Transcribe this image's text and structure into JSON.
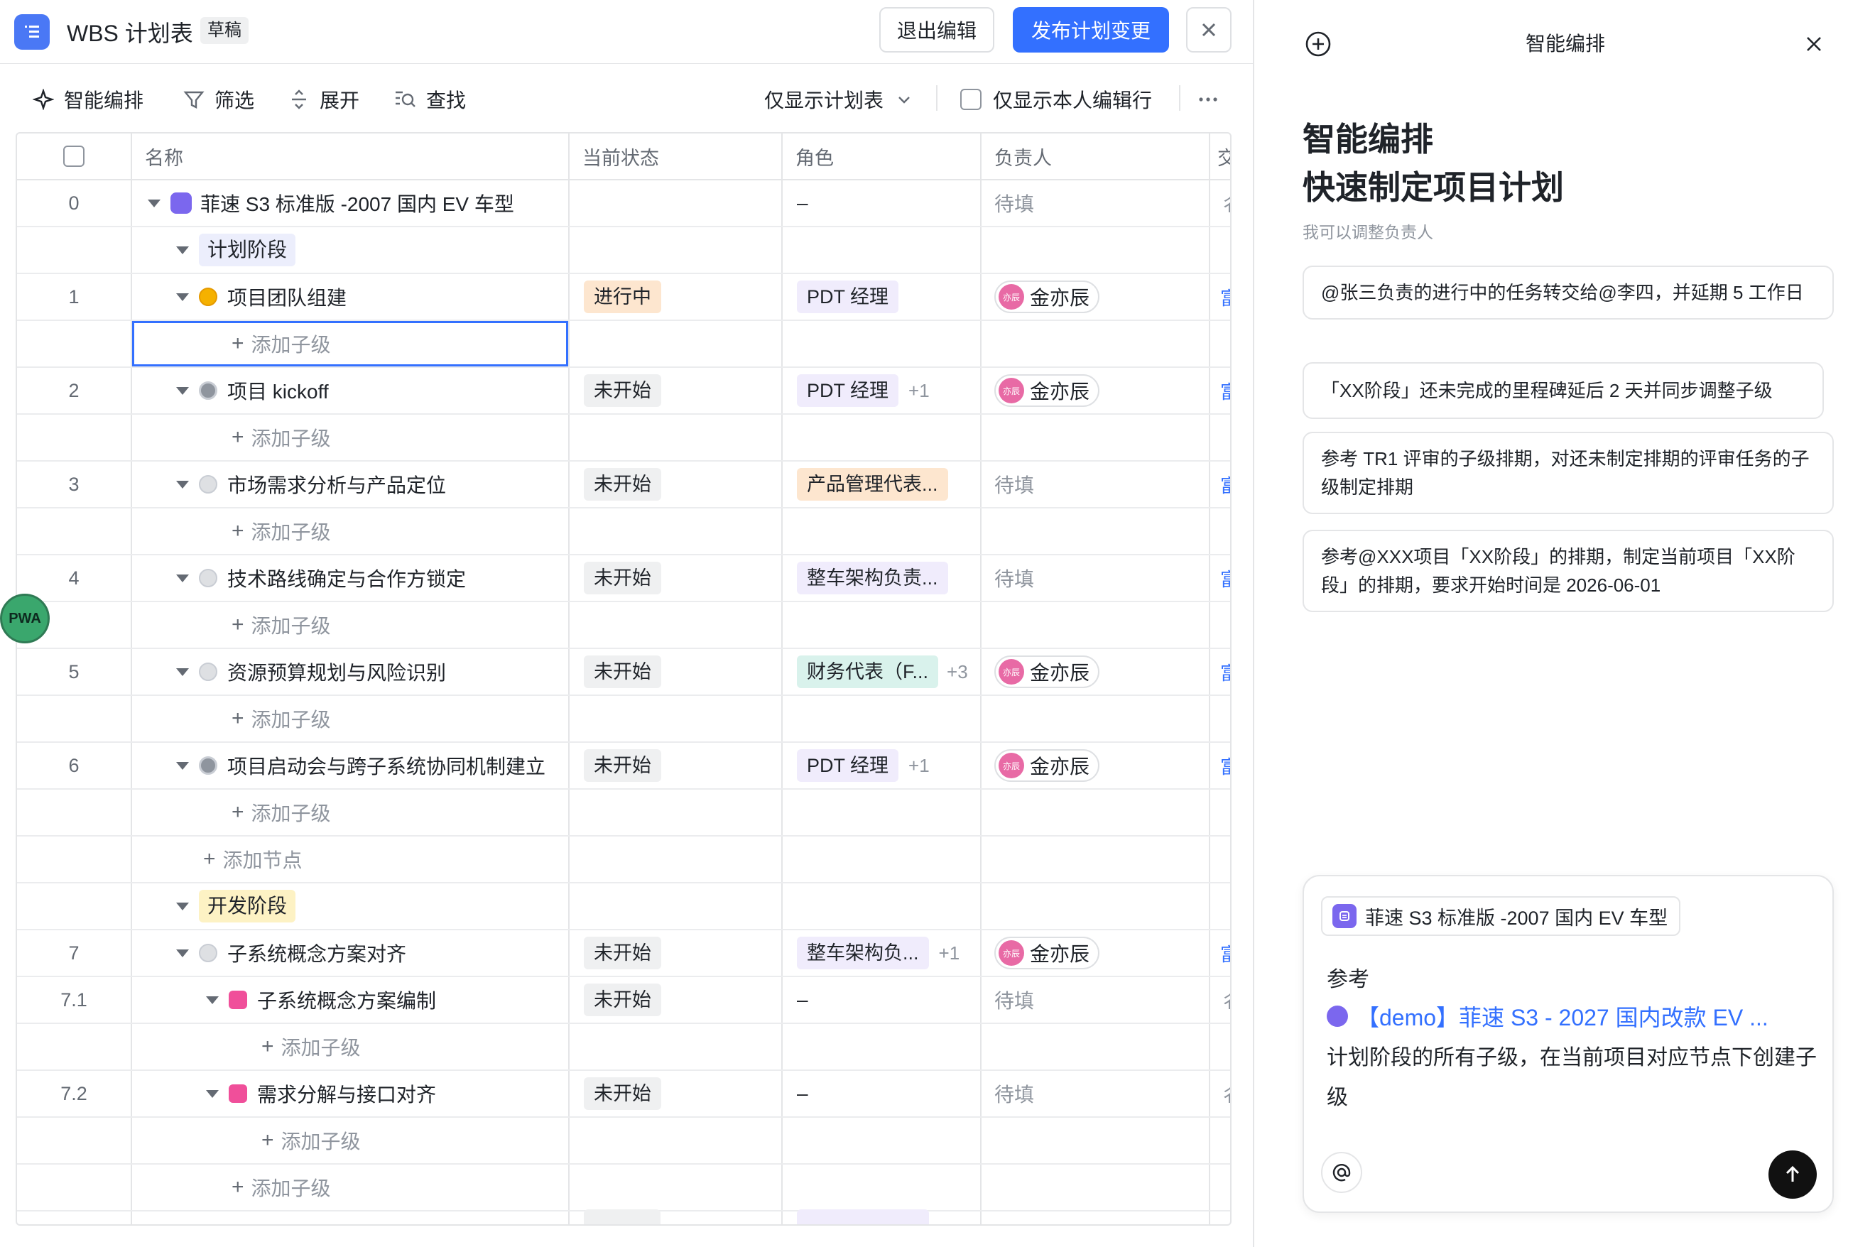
{
  "header": {
    "title": "WBS 计划表",
    "draft": "草稿",
    "exit": "退出编辑",
    "publish": "发布计划变更"
  },
  "toolbar": {
    "smart": "智能编排",
    "filter": "筛选",
    "expand": "展开",
    "find": "查找",
    "view": "仅显示计划表",
    "only_mine": "仅显示本人编辑行"
  },
  "columns": {
    "name": "名称",
    "status": "当前状态",
    "role": "角色",
    "owner": "负责人"
  },
  "rows": {
    "r0": {
      "idx": "0",
      "name": "菲速 S3 标准版 -2007 国内 EV 车型",
      "role": "–",
      "owner": "待填"
    },
    "p1": {
      "name": "计划阶段"
    },
    "r1": {
      "idx": "1",
      "name": "项目团队组建",
      "status": "进行中",
      "role": "PDT 经理",
      "owner": "金亦辰"
    },
    "r2": {
      "idx": "2",
      "name": "项目 kickoff",
      "status": "未开始",
      "role": "PDT 经理",
      "extra": "+1",
      "owner": "金亦辰"
    },
    "r3": {
      "idx": "3",
      "name": "市场需求分析与产品定位",
      "status": "未开始",
      "role": "产品管理代表...",
      "owner": "待填"
    },
    "r4": {
      "idx": "4",
      "name": "技术路线确定与合作方锁定",
      "status": "未开始",
      "role": "整车架构负责...",
      "owner": "待填"
    },
    "r5": {
      "idx": "5",
      "name": "资源预算规划与风险识别",
      "status": "未开始",
      "role": "财务代表（F...",
      "extra": "+3",
      "owner": "金亦辰"
    },
    "r6": {
      "idx": "6",
      "name": "项目启动会与跨子系统协同机制建立",
      "status": "未开始",
      "role": "PDT 经理",
      "extra": "+1",
      "owner": "金亦辰"
    },
    "p2": {
      "name": "开发阶段"
    },
    "r7": {
      "idx": "7",
      "name": "子系统概念方案对齐",
      "status": "未开始",
      "role": "整车架构负...",
      "extra": "+1",
      "owner": "金亦辰"
    },
    "r71": {
      "idx": "7.1",
      "name": "子系统概念方案编制",
      "status": "未开始",
      "role": "–",
      "owner": "待填"
    },
    "r72": {
      "idx": "7.2",
      "name": "需求分解与接口对齐",
      "status": "未开始",
      "role": "–",
      "owner": "待填"
    },
    "add_child": "添加子级",
    "add_node": "添加节点",
    "avatar_text": "亦辰",
    "pwa": "PWA"
  },
  "panel": {
    "title": "智能编排",
    "big1": "智能编排",
    "big2": "快速制定项目计划",
    "hint": "我可以调整负责人",
    "s1": "@张三负责的进行中的任务转交给@李四，并延期 5 工作日",
    "s2": "「XX阶段」还未完成的里程碑延后 2 天并同步调整子级",
    "s3": "参考 TR1 评审的子级排期，对还未制定排期的评审任务的子级制定排期",
    "s4": "参考@XXX项目「XX阶段」的排期，制定当前项目「XX阶段」的排期，要求开始时间是 2026-06-01",
    "chip": "菲速 S3 标准版 -2007 国内 EV 车型",
    "ref": "参考",
    "link": "【demo】菲速 S3 - 2027 国内改款 EV ...",
    "text": "计划阶段的所有子级，在当前项目对应节点下创建子级"
  },
  "colors": {
    "accent": "#3370ff",
    "progress_tag": "#fde6cf",
    "phase_plan": "#eceefc",
    "phase_dev": "#fdf2c4"
  }
}
